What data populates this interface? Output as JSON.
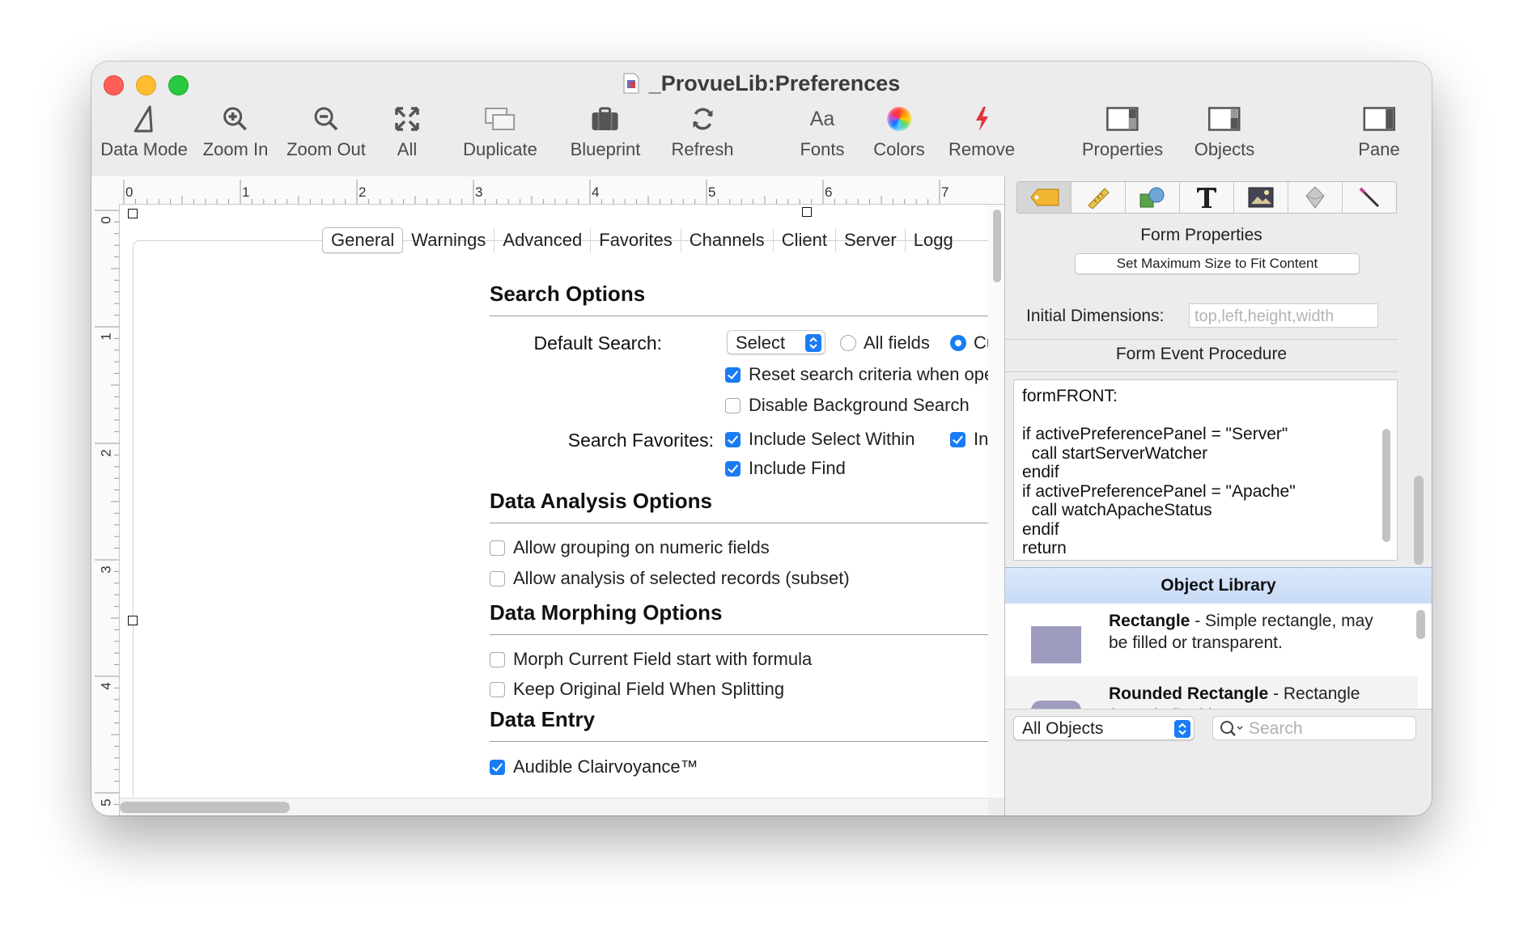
{
  "window": {
    "title": "_ProvueLib:Preferences"
  },
  "toolbar": {
    "items": [
      {
        "label": "Data Mode",
        "icon": "data-mode-icon"
      },
      {
        "label": "Zoom In",
        "icon": "zoom-in-icon"
      },
      {
        "label": "Zoom Out",
        "icon": "zoom-out-icon"
      },
      {
        "label": "All",
        "icon": "fit-all-icon"
      },
      {
        "label": "Duplicate",
        "icon": "duplicate-icon"
      },
      {
        "label": "Blueprint",
        "icon": "briefcase-icon"
      },
      {
        "label": "Refresh",
        "icon": "refresh-icon"
      },
      {
        "label": "Fonts",
        "icon": "fonts-icon",
        "glyph": "Aa"
      },
      {
        "label": "Colors",
        "icon": "color-wheel-icon"
      },
      {
        "label": "Remove",
        "icon": "lightning-icon"
      },
      {
        "label": "Properties",
        "icon": "properties-pane-icon"
      },
      {
        "label": "Objects",
        "icon": "objects-pane-icon"
      },
      {
        "label": "Pane",
        "icon": "pane-icon"
      }
    ]
  },
  "ruler": {
    "top_labels": [
      "0",
      "1",
      "2",
      "3",
      "4",
      "5",
      "6",
      "7"
    ],
    "left_labels": [
      "0",
      "1",
      "2",
      "3",
      "4",
      "5"
    ]
  },
  "form": {
    "tabs": [
      "General",
      "Warnings",
      "Advanced",
      "Favorites",
      "Channels",
      "Client",
      "Server",
      "Logg"
    ],
    "search_options": {
      "heading": "Search Options",
      "default_search_label": "Default Search:",
      "default_search_value": "Select",
      "radio_all_fields": "All fields",
      "radio_current_field": "Current fie",
      "reset_search": "Reset search criteria when opening di",
      "disable_bg_search": "Disable Background Search",
      "favorites_label": "Search Favorites:",
      "include_select_within": "Include Select Within",
      "include_select": "Include Sele",
      "include_find": "Include Find"
    },
    "data_analysis": {
      "heading": "Data Analysis Options",
      "allow_grouping": "Allow grouping on numeric fields",
      "allow_analysis": "Allow analysis of selected records (subset)"
    },
    "data_morphing": {
      "heading": "Data Morphing Options",
      "morph_current": "Morph Current Field start with formula",
      "keep_original": "Keep Original Field When Splitting"
    },
    "data_entry": {
      "heading": "Data Entry",
      "audible": "Audible Clairvoyance™"
    }
  },
  "properties_panel": {
    "form_properties_title": "Form Properties",
    "set_max_button": "Set Maximum Size to Fit Content",
    "initial_dimensions_label": "Initial Dimensions:",
    "initial_dimensions_placeholder": "top,left,height,width",
    "form_event_title": "Form Event Procedure",
    "code": "formFRONT:\n\nif activePreferencePanel = \"Server\"\n  call startServerWatcher\nendif\nif activePreferencePanel = \"Apache\"\n  call watchApacheStatus\nendif\nreturn",
    "tool_icons": [
      "tag-icon",
      "ruler-icon",
      "shapes-icon",
      "text-tool-icon",
      "image-icon",
      "eraser-icon",
      "wand-icon"
    ]
  },
  "object_library": {
    "title": "Object Library",
    "items": [
      {
        "name": "Rectangle",
        "desc": " - Simple rectangle, may be filled or transparent."
      },
      {
        "name": "Rounded Rectangle",
        "desc": " - Rectangle (rounded) with"
      }
    ],
    "filter_value": "All Objects",
    "search_placeholder": "Search"
  },
  "colors": {
    "accent": "#1a7cf5",
    "object_swatch": "#9d9cbf",
    "library_header": "#c8daf6"
  }
}
